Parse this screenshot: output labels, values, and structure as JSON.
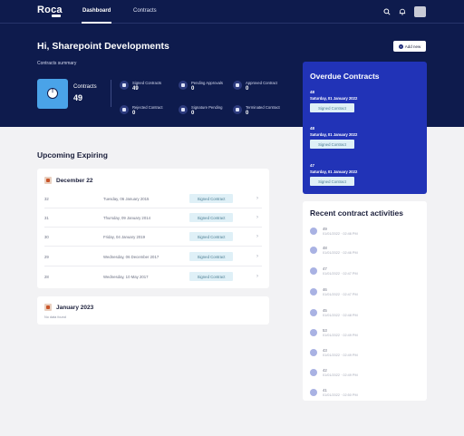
{
  "nav": {
    "logo": "Roca",
    "tabs": [
      {
        "label": "Dashboard",
        "active": true
      },
      {
        "label": "Contracts",
        "active": false
      }
    ],
    "icons": [
      "search-icon",
      "bell-icon",
      "user-avatar"
    ]
  },
  "header": {
    "greeting_prefix": "Hi, ",
    "user_name": "Sharepoint Developments",
    "subtitle": "Contracts summary",
    "add_button": "Add new"
  },
  "summary": {
    "contracts_label": "Contracts",
    "contracts_count": "49",
    "stats": [
      {
        "label": "Signed Contracts",
        "value": "49",
        "icon": "signature-icon"
      },
      {
        "label": "Pending Approvals",
        "value": "0",
        "icon": "clipboard-icon"
      },
      {
        "label": "Approved Contract",
        "value": "0",
        "icon": "approve-icon"
      },
      {
        "label": "Rejected Contract",
        "value": "0",
        "icon": "reject-icon"
      },
      {
        "label": "Signature Pending",
        "value": "0",
        "icon": "pending-doc-icon"
      },
      {
        "label": "Terminated Contract",
        "value": "0",
        "icon": "terminate-icon"
      }
    ]
  },
  "overdue": {
    "title": "Overdue Contracts",
    "items": [
      {
        "id": "48",
        "date": "Saturday, 01 January 2022",
        "status": "Signed Contract"
      },
      {
        "id": "48",
        "date": "Saturday, 01 January 2022",
        "status": "Signed Contract"
      },
      {
        "id": "47",
        "date": "Saturday, 01 January 2022",
        "status": "Signed Contract"
      }
    ]
  },
  "upcoming": {
    "title": "Upcoming Expiring",
    "months": [
      {
        "label": "December 22",
        "rows": [
          {
            "id": "32",
            "date": "Tuesday, 06 January 2015",
            "status": "Signed Contract"
          },
          {
            "id": "31",
            "date": "Thursday, 09 January 2014",
            "status": "Signed Contract"
          },
          {
            "id": "30",
            "date": "Friday, 04 January 2019",
            "status": "Signed Contract"
          },
          {
            "id": "29",
            "date": "Wednesday, 06 December 2017",
            "status": "Signed Contract"
          },
          {
            "id": "28",
            "date": "Wednesday, 10 May 2017",
            "status": "Signed Contract"
          }
        ]
      },
      {
        "label": "January 2023",
        "empty_text": "No data found"
      }
    ]
  },
  "recent": {
    "title": "Recent contract activities",
    "items": [
      {
        "id": "49",
        "timestamp": "01/01/2022 · 02:46 PM"
      },
      {
        "id": "48",
        "timestamp": "01/01/2022 · 02:46 PM"
      },
      {
        "id": "47",
        "timestamp": "01/01/2022 · 02:47 PM"
      },
      {
        "id": "46",
        "timestamp": "01/01/2022 · 02:47 PM"
      },
      {
        "id": "45",
        "timestamp": "01/01/2022 · 02:48 PM"
      },
      {
        "id": "53",
        "timestamp": "01/01/2022 · 02:49 PM"
      },
      {
        "id": "43",
        "timestamp": "01/01/2022 · 02:49 PM"
      },
      {
        "id": "42",
        "timestamp": "01/01/2022 · 02:49 PM"
      },
      {
        "id": "41",
        "timestamp": "01/01/2022 · 02:50 PM"
      }
    ]
  },
  "colors": {
    "header_bg": "#0e1b4d",
    "overdue_bg": "#2133b7",
    "tile_bg": "#4aa3e8",
    "tag_bg": "#dff0f7",
    "page_bg": "#f2f2f4"
  }
}
